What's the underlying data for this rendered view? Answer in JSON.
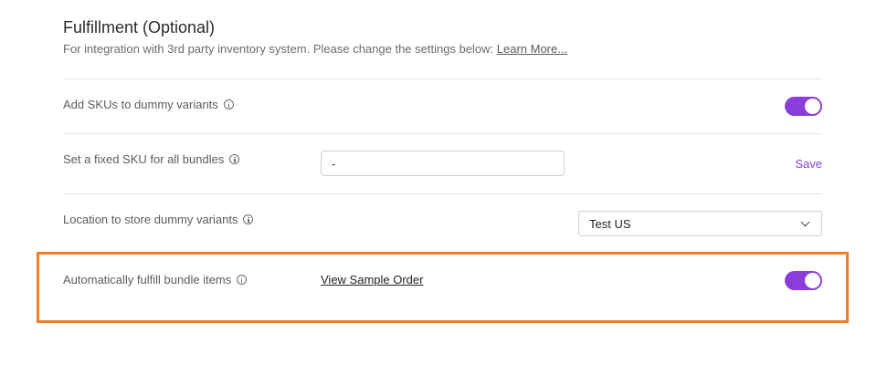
{
  "header": {
    "title": "Fulfillment (Optional)",
    "subtitle": "For integration with 3rd party inventory system. Please change the settings below:",
    "learn_more": "Learn More..."
  },
  "rows": {
    "add_skus": {
      "label": "Add SKUs to dummy variants",
      "toggle_on": true
    },
    "fixed_sku": {
      "label": "Set a fixed SKU for all bundles",
      "value": "-",
      "save_label": "Save"
    },
    "location": {
      "label": "Location to store dummy variants",
      "selected": "Test US"
    },
    "auto_fulfill": {
      "label": "Automatically fulfill bundle items",
      "link": "View Sample Order",
      "toggle_on": true
    }
  },
  "colors": {
    "accent": "#8a3ddb",
    "highlight": "#f07f2a"
  }
}
